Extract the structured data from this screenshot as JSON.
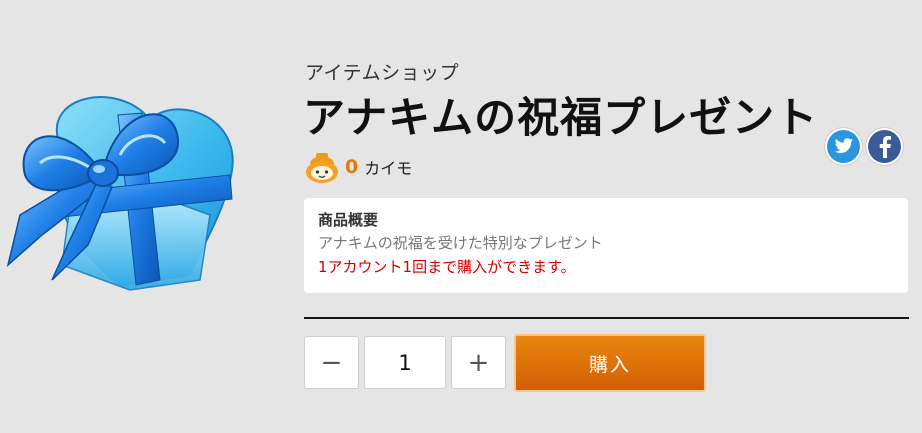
{
  "product": {
    "category": "アイテムショップ",
    "title": "アナキムの祝福プレゼント",
    "price_value": "0",
    "price_unit": "カイモ"
  },
  "overview": {
    "heading": "商品概要",
    "description": "アナキムの祝福を受けた特別なプレゼント",
    "note": "1アカウント1回まで購入ができます。"
  },
  "purchase": {
    "minus_label": "−",
    "quantity": "1",
    "plus_label": "+",
    "buy_label": "購入"
  },
  "icons": {
    "share": [
      "twitter-icon",
      "facebook-icon"
    ],
    "currency": "kaimo-coin-icon"
  },
  "colors": {
    "background": "#e5e5e5",
    "price": "#e07a10",
    "note": "#d40000",
    "buy_button": "#e07a10",
    "twitter": "#2a96e0",
    "facebook": "#3a5a98"
  }
}
